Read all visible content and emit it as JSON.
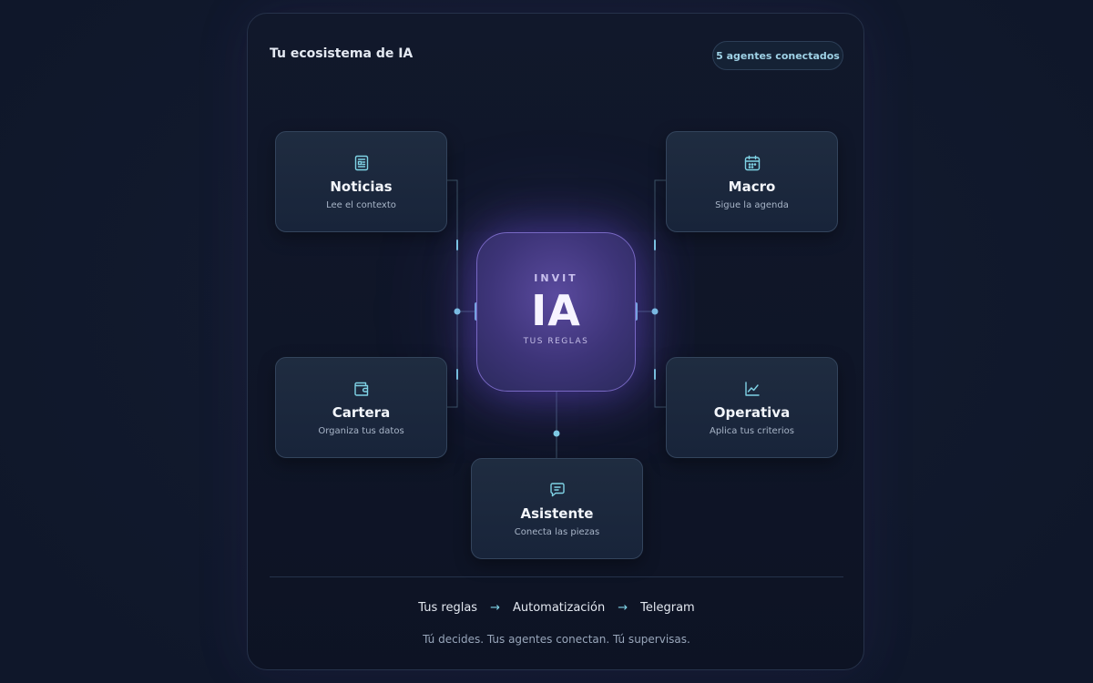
{
  "header": {
    "title": "Tu ecosistema de IA",
    "badge": "5 agentes conectados"
  },
  "hub": {
    "prefix": "INVIT",
    "main": "IA",
    "suffix": "TUS REGLAS"
  },
  "agents": [
    {
      "title": "Noticias",
      "subtitle": "Lee el contexto",
      "icon": "newspaper-icon"
    },
    {
      "title": "Macro",
      "subtitle": "Sigue la agenda",
      "icon": "calendar-icon"
    },
    {
      "title": "Cartera",
      "subtitle": "Organiza tus datos",
      "icon": "wallet-icon"
    },
    {
      "title": "Operativa",
      "subtitle": "Aplica tus criterios",
      "icon": "line-chart-icon"
    },
    {
      "title": "Asistente",
      "subtitle": "Conecta las piezas",
      "icon": "chat-icon"
    }
  ],
  "footer": {
    "flow": [
      "Tus reglas",
      "Automatización",
      "Telegram"
    ],
    "arrow": "→",
    "tagline": "Tú decides. Tus agentes conectan. Tú supervisas."
  },
  "colors": {
    "accent": "#7fd3e6",
    "hub": "#4a3f8c",
    "card": "#1c2a3e",
    "background": "#0f172a"
  }
}
